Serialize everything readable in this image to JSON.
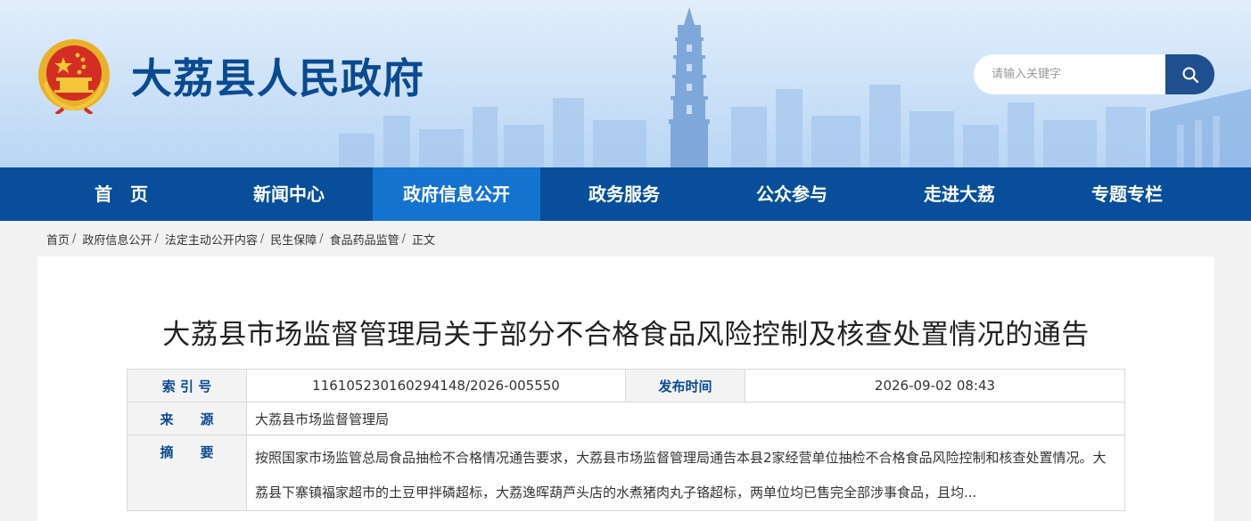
{
  "header": {
    "site_title": "大荔县人民政府",
    "emblem_icon": "national-emblem-icon",
    "search": {
      "placeholder": "请输入关键字",
      "button_icon": "search-icon"
    }
  },
  "nav": {
    "items": [
      {
        "label": "首　页",
        "active": false
      },
      {
        "label": "新闻中心",
        "active": false
      },
      {
        "label": "政府信息公开",
        "active": true
      },
      {
        "label": "政务服务",
        "active": false
      },
      {
        "label": "公众参与",
        "active": false
      },
      {
        "label": "走进大荔",
        "active": false
      },
      {
        "label": "专题专栏",
        "active": false
      }
    ]
  },
  "breadcrumb": {
    "items": [
      "首页",
      "政府信息公开",
      "法定主动公开内容",
      "民生保障",
      "食品药品监管",
      "正文"
    ],
    "separator": "/"
  },
  "article": {
    "title": "大荔县市场监督管理局关于部分不合格食品风险控制及核查处置情况的通告",
    "meta": {
      "index_label": "索 引 号",
      "index_value": "11610523016029414​8/2026-005550",
      "publish_time_label": "发布时间",
      "publish_time_value": "2026-09-02 08:43",
      "source_label": "来　　源",
      "source_value": "大荔县市场监督管理局",
      "abstract_label": "摘　　要",
      "abstract_value": "按照国家市场监管总局食品抽检不合格情况通告要求，大荔县市场监督管理局通告本县2家经营单位抽检不合格食品风险控制和核查处置情况。大荔县下寨镇福家超市的土豆甲拌磷超标，大荔逸晖葫芦头店的水煮猪肉丸子铬超标，两单位均已售完全部涉事食品，且均..."
    }
  },
  "colors": {
    "nav_bg": "#084e9a",
    "nav_active": "#1473cf",
    "title_blue": "#0b4a92",
    "search_button": "#1f4f8f"
  }
}
